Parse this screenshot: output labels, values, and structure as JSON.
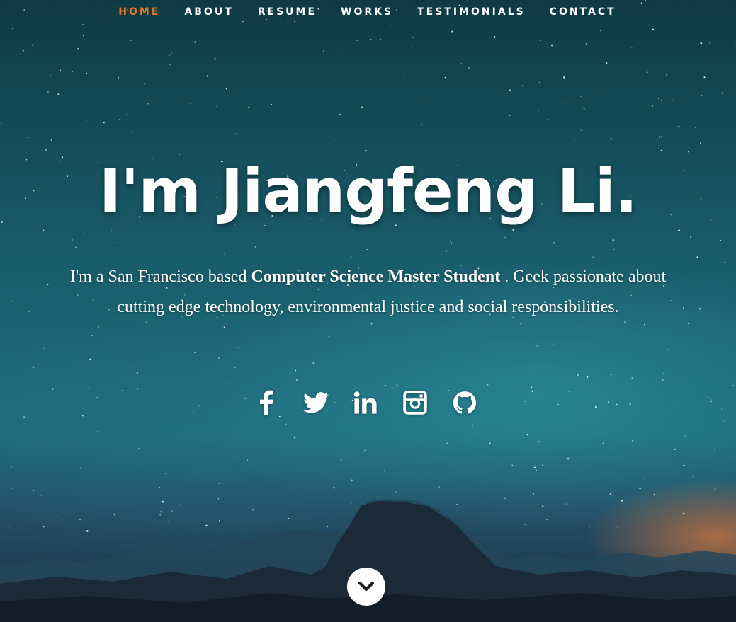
{
  "nav": {
    "items": [
      {
        "label": "HOME",
        "active": true
      },
      {
        "label": "ABOUT",
        "active": false
      },
      {
        "label": "RESUME",
        "active": false
      },
      {
        "label": "WORKS",
        "active": false
      },
      {
        "label": "TESTIMONIALS",
        "active": false
      },
      {
        "label": "CONTACT",
        "active": false
      }
    ],
    "active_color": "#e57923"
  },
  "banner": {
    "headline": "I'm Jiangfeng Li.",
    "tagline": {
      "part1": "I'm a San Francisco based ",
      "emphasis": "Computer Science Master Student",
      "part2": " . Geek passionate about cutting edge technology, environmental justice and social responsibilities."
    }
  },
  "social": [
    {
      "icon": "facebook-icon"
    },
    {
      "icon": "twitter-icon"
    },
    {
      "icon": "linkedin-icon"
    },
    {
      "icon": "instagram-icon"
    },
    {
      "icon": "github-icon"
    }
  ],
  "scroll_down": {
    "icon": "chevron-down-icon"
  },
  "colors": {
    "sky_top": "#0f3a44",
    "sky_mid": "#1d6c7b",
    "horizon_glow": "#d6783c",
    "mountain": "#1b2a36"
  }
}
